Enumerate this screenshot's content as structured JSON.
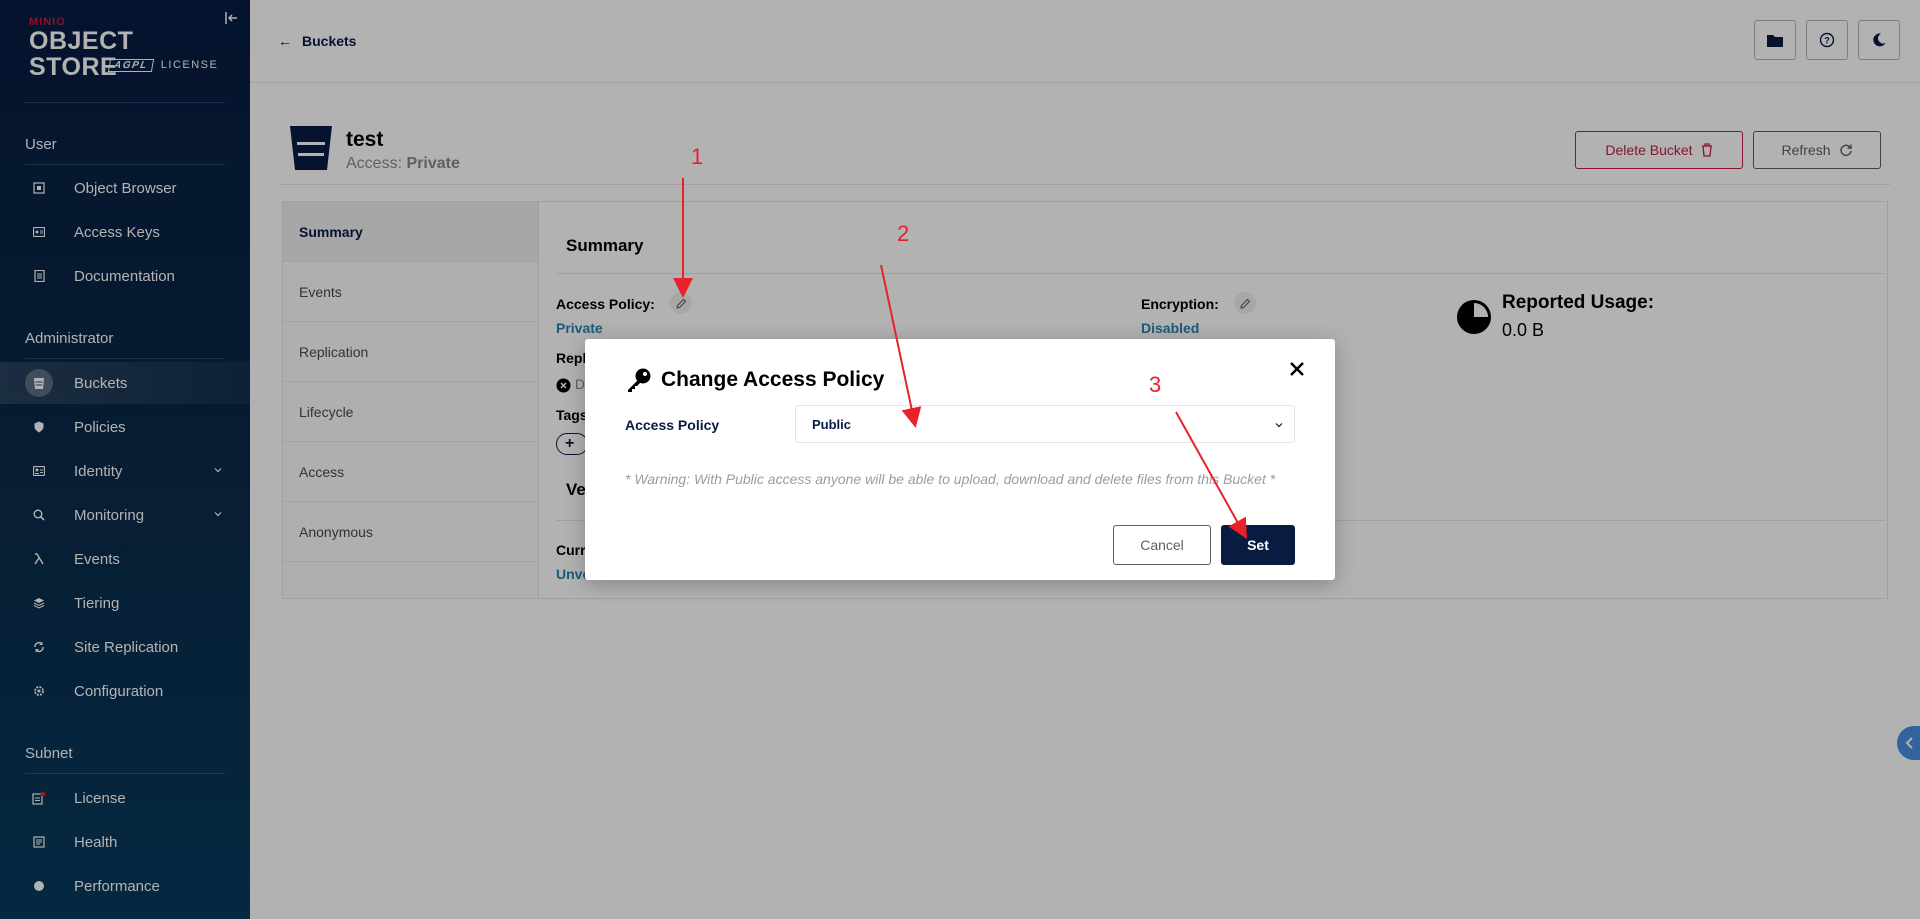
{
  "logo": {
    "brand": "MINIO",
    "product": "OBJECT STORE",
    "edition": "AGPL",
    "license": "LICENSE"
  },
  "sidebar": {
    "sections": [
      {
        "title": "User",
        "items": [
          {
            "label": "Object Browser",
            "icon": "object-browser-icon"
          },
          {
            "label": "Access Keys",
            "icon": "access-keys-icon"
          },
          {
            "label": "Documentation",
            "icon": "documentation-icon"
          }
        ]
      },
      {
        "title": "Administrator",
        "items": [
          {
            "label": "Buckets",
            "icon": "buckets-icon",
            "active": true
          },
          {
            "label": "Policies",
            "icon": "policies-icon"
          },
          {
            "label": "Identity",
            "icon": "identity-icon",
            "expandable": true
          },
          {
            "label": "Monitoring",
            "icon": "monitoring-icon",
            "expandable": true
          },
          {
            "label": "Events",
            "icon": "lambda-icon"
          },
          {
            "label": "Tiering",
            "icon": "tiering-icon"
          },
          {
            "label": "Site Replication",
            "icon": "site-replication-icon"
          },
          {
            "label": "Configuration",
            "icon": "configuration-icon"
          }
        ]
      },
      {
        "title": "Subnet",
        "items": [
          {
            "label": "License",
            "icon": "license-icon"
          },
          {
            "label": "Health",
            "icon": "health-icon"
          },
          {
            "label": "Performance",
            "icon": "performance-icon"
          }
        ]
      }
    ]
  },
  "header": {
    "back_label": "Buckets"
  },
  "bucket": {
    "name": "test",
    "access_prefix": "Access:",
    "access_value": "Private",
    "delete_label": "Delete Bucket",
    "refresh_label": "Refresh"
  },
  "tabs": [
    "Summary",
    "Events",
    "Replication",
    "Lifecycle",
    "Access",
    "Anonymous"
  ],
  "summary": {
    "title": "Summary",
    "access_policy_label": "Access Policy:",
    "access_policy_value": "Private",
    "encryption_label": "Encryption:",
    "encryption_value": "Disabled",
    "reported_usage_label": "Reported Usage:",
    "reported_usage_value": "0.0 B",
    "replication_partial": "Repl",
    "replication_value_partial": "D",
    "tags_partial": "Tags",
    "versioning_partial": "Ve",
    "current_partial": "Curr",
    "unversioned_partial": "Unve"
  },
  "modal": {
    "title": "Change Access Policy",
    "policy_label": "Access Policy",
    "policy_selected": "Public",
    "warning": "* Warning: With Public access anyone will be able to upload, download and delete files from this Bucket *",
    "cancel_label": "Cancel",
    "set_label": "Set"
  },
  "annotations": [
    "1",
    "2",
    "3"
  ],
  "colors": {
    "sidebar": "#081c42",
    "accent": "#2781b0",
    "danger": "#c51b3f",
    "annotation": "#e8212b"
  }
}
